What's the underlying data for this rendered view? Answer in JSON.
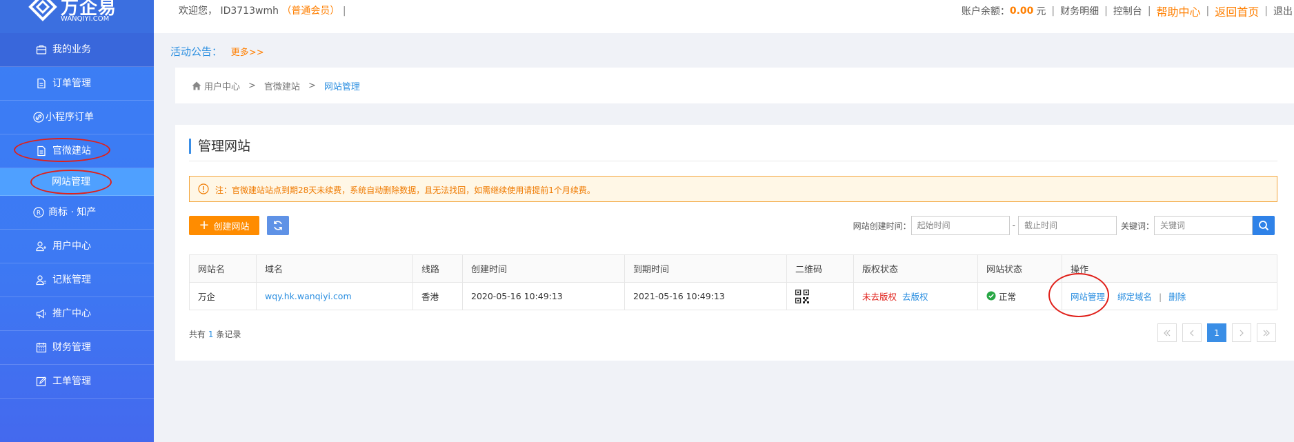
{
  "logo": {
    "brand": "万企易",
    "site": "WANQIYI.COM"
  },
  "topbar": {
    "welcome_prefix": "欢迎您，",
    "user_id": "ID3713wmh",
    "member_level": "（普通会员）",
    "balance_label": "账户余额：",
    "balance_value": "0.00",
    "balance_unit": "元",
    "links": {
      "finance_detail": "财务明细",
      "console": "控制台",
      "help": "帮助中心",
      "home": "返回首页",
      "logout": "退出"
    }
  },
  "sidebar": {
    "items": [
      {
        "label": "我的业务",
        "icon": "briefcase-icon"
      },
      {
        "label": "订单管理",
        "icon": "document-icon"
      },
      {
        "label": "小程序订单",
        "icon": "link-icon"
      },
      {
        "label": "官微建站",
        "icon": "document-icon"
      },
      {
        "label": "网站管理",
        "icon": ""
      },
      {
        "label": "商标 · 知产",
        "icon": "registered-icon"
      },
      {
        "label": "用户中心",
        "icon": "users-icon"
      },
      {
        "label": "记账管理",
        "icon": "users-icon"
      },
      {
        "label": "推广中心",
        "icon": "megaphone-icon"
      },
      {
        "label": "财务管理",
        "icon": "calendar-icon"
      },
      {
        "label": "工单管理",
        "icon": "edit-icon"
      }
    ]
  },
  "notice": {
    "label": "活动公告：",
    "more": "更多>>"
  },
  "breadcrumb": {
    "home": "用户中心",
    "parent": "官微建站",
    "current": "网站管理",
    "separator": ">"
  },
  "main": {
    "title": "管理网站",
    "alert": "注：官微建站站点到期28天未续费，系统自动删除数据，且无法找回，如需继续使用请提前1个月续费。",
    "create_button": "创建网站",
    "filter": {
      "created_label": "网站创建时间：",
      "start_placeholder": "起始时间",
      "dash": "-",
      "end_placeholder": "截止时间",
      "keyword_label": "关键词：",
      "keyword_placeholder": "关键词"
    },
    "table": {
      "headers": [
        "网站名",
        "域名",
        "线路",
        "创建时间",
        "到期时间",
        "二维码",
        "版权状态",
        "网站状态",
        "操作"
      ],
      "rows": [
        {
          "name": "万企",
          "domain": "wqy.hk.wanqiyi.com",
          "route": "香港",
          "created": "2020-05-16 10:49:13",
          "expires": "2021-05-16 10:49:13",
          "copyright_status": "未去版权",
          "copyright_action": "去版权",
          "site_status": "正常",
          "actions": {
            "manage": "网站管理",
            "bind": "绑定域名",
            "delete": "删除"
          }
        }
      ]
    },
    "records": {
      "prefix": "共有",
      "count": "1",
      "suffix": "条记录"
    },
    "pager": {
      "current": "1"
    }
  },
  "colors": {
    "sidebar": "#3d79f3",
    "accent": "#2a8ee0",
    "orange": "#ff8c00",
    "annotation": "#e0201a"
  }
}
